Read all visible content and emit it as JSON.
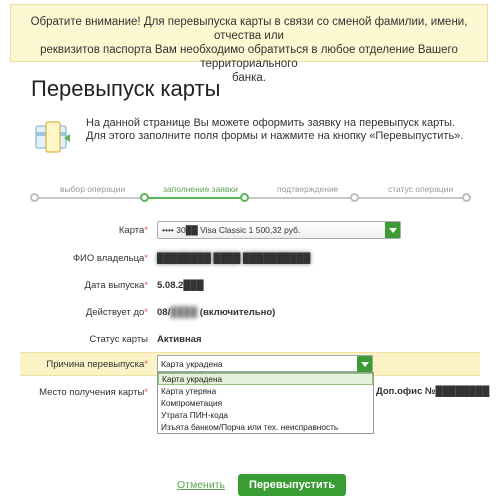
{
  "notice": {
    "line1": "Обратите внимание! Для перевыпуска карты в связи со сменой фамилии, имени, отчества или",
    "line2": "реквизитов паспорта Вам необходимо обратиться в любое отделение Вашего территориального",
    "line3": "банка."
  },
  "page_title": "Перевыпуск карты",
  "intro": {
    "text": "На данной странице Вы можете оформить заявку на перевыпуск карты. Для этого заполните поля формы и нажмите на кнопку «Перевыпустить».",
    "icon": "card-reissue-icon"
  },
  "steps": [
    {
      "label": "выбор операции",
      "state": "done"
    },
    {
      "label": "заполнение заявки",
      "state": "active"
    },
    {
      "label": "подтверждение",
      "state": "pending"
    },
    {
      "label": "статус операции",
      "state": "pending"
    }
  ],
  "form": {
    "card": {
      "label": "Карта",
      "value": "•••• 30██ Visa Classic 1 500,32 руб."
    },
    "owner": {
      "label": "ФИО владельца",
      "value": "████████ ████ ██████████"
    },
    "issue_date": {
      "label": "Дата выпуска",
      "value": "5.08.2███"
    },
    "valid_to": {
      "label": "Действует до",
      "value_prefix": "08/",
      "value_blur": "████",
      "value_suffix": "(включительно)"
    },
    "status": {
      "label": "Статус карты",
      "value": "Активная"
    },
    "reason": {
      "label": "Причина перевыпуска",
      "value": "Карта украдена"
    },
    "pickup": {
      "label": "Место получения карты",
      "value": "Доп.офис №████████"
    }
  },
  "reason_options": [
    "Карта украдена",
    "Карта утеряна",
    "Компрометация",
    "Утрата ПИН-кода",
    "Изъятa банком/Порча или тех. неисправность"
  ],
  "actions": {
    "cancel": "Отменить",
    "submit": "Перевыпустить"
  },
  "colors": {
    "accent_green": "#3a9d34",
    "notice_bg": "#fdf7d2",
    "highlight_band": "#fbf3c5"
  }
}
